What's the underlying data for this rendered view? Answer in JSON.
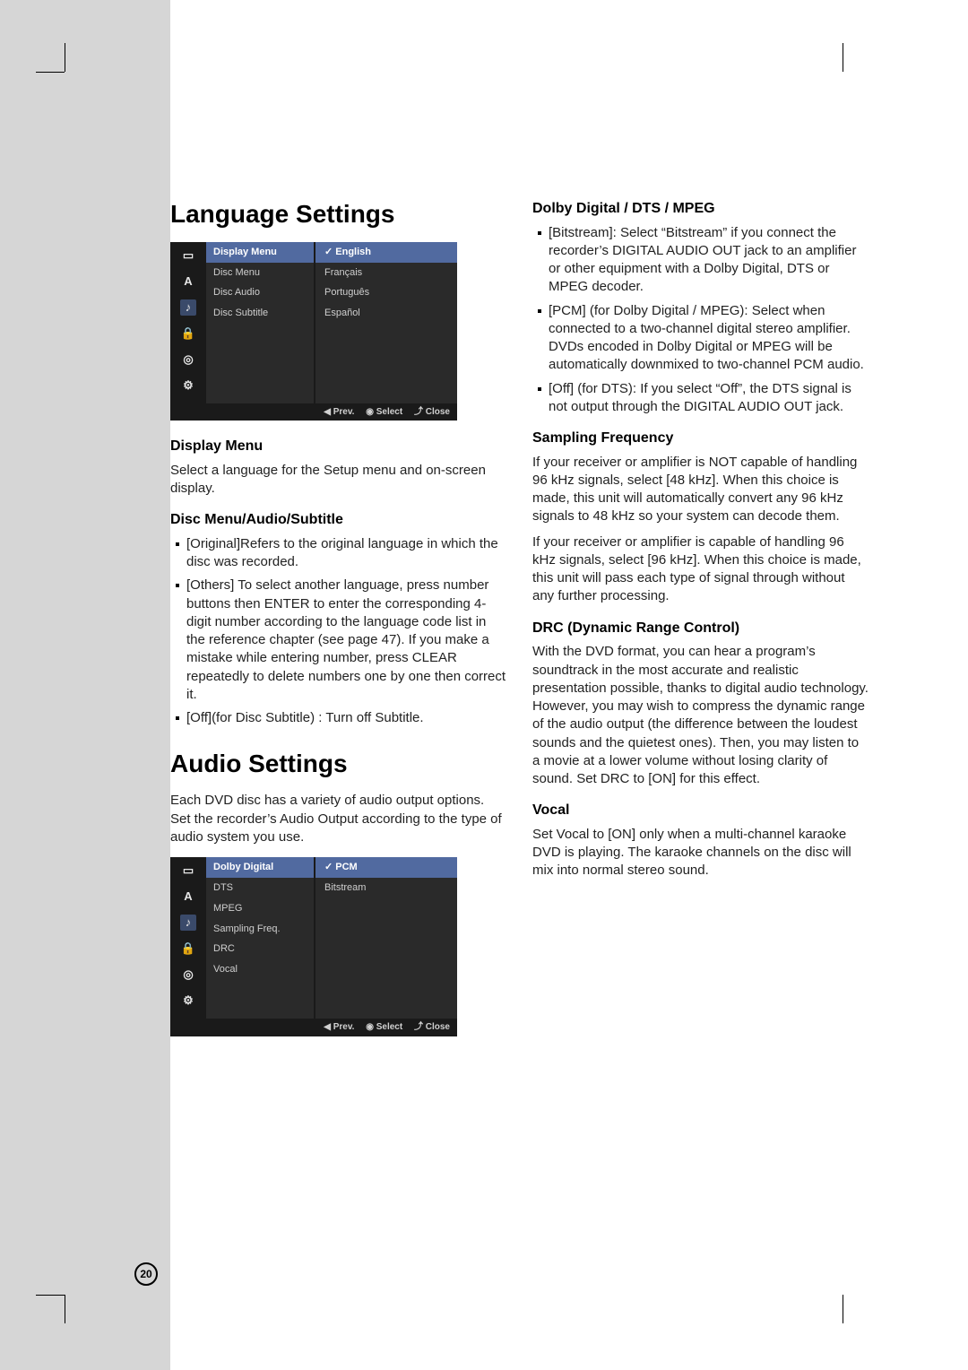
{
  "page_number": "20",
  "left": {
    "heading1": "Language Settings",
    "osd1": {
      "icons": [
        "tv",
        "A",
        "aud",
        "lock",
        "disc",
        "gear"
      ],
      "items": [
        "Display Menu",
        "Disc Menu",
        "Disc Audio",
        "Disc Subtitle"
      ],
      "selected_item": 0,
      "options": [
        "English",
        "Français",
        "Português",
        "Español"
      ],
      "selected_option": 0,
      "footer": {
        "prev": "◀ Prev.",
        "select": "◉ Select",
        "close": "⤴ Close"
      }
    },
    "display_menu_h": "Display Menu",
    "display_menu_p": "Select a language for the Setup menu and on-screen display.",
    "disc_h": "Disc Menu/Audio/Subtitle",
    "disc_bullets": [
      "[Original]Refers to the original language in which the disc was recorded.",
      "[Others] To select another language, press number buttons then ENTER to enter the corresponding 4-digit number according to the language code list in the reference chapter (see page 47). If you make a mistake while entering number, press CLEAR repeatedly to delete numbers one by one then correct it.",
      "[Off](for Disc Subtitle) : Turn off Subtitle."
    ],
    "heading2": "Audio Settings",
    "audio_intro": "Each DVD disc has a variety of audio output options. Set the recorder’s Audio Output according to the type of audio system you use.",
    "osd2": {
      "icons": [
        "tv",
        "A",
        "aud",
        "lock",
        "disc",
        "gear"
      ],
      "items": [
        "Dolby Digital",
        "DTS",
        "MPEG",
        "Sampling Freq.",
        "DRC",
        "Vocal"
      ],
      "selected_item": 0,
      "options": [
        "PCM",
        "Bitstream"
      ],
      "selected_option": 0,
      "footer": {
        "prev": "◀ Prev.",
        "select": "◉ Select",
        "close": "⤴ Close"
      }
    }
  },
  "right": {
    "dolby_h": "Dolby Digital / DTS / MPEG",
    "dolby_bullets": [
      "[Bitstream]: Select “Bitstream” if you connect the recorder’s DIGITAL AUDIO OUT jack to an amplifier or other equipment with a Dolby Digital, DTS or MPEG decoder.",
      "[PCM] (for Dolby Digital / MPEG): Select when connected to a two-channel digital stereo amplifier. DVDs encoded in Dolby Digital or MPEG will be automatically downmixed to two-channel PCM audio.",
      "[Off] (for DTS): If you select “Off”, the DTS signal is not output through the DIGITAL AUDIO OUT jack."
    ],
    "sampling_h": "Sampling Frequency",
    "sampling_p1": "If your receiver or amplifier is NOT capable of handling 96 kHz signals, select [48 kHz]. When this choice is made, this unit will automatically convert any 96 kHz signals to 48 kHz so your system can decode them.",
    "sampling_p2": "If your receiver or amplifier is capable of handling 96 kHz signals, select [96 kHz]. When this choice is made, this unit will pass each type of signal through without any further processing.",
    "drc_h": "DRC (Dynamic Range Control)",
    "drc_p": "With the DVD format, you can hear a program’s soundtrack in the most accurate and realistic presentation possible, thanks to digital audio technology. However, you may wish to compress the dynamic range of the audio output (the difference between the loudest sounds and the quietest ones). Then, you may listen to a movie at a lower volume without losing clarity of sound. Set DRC to [ON] for this effect.",
    "vocal_h": "Vocal",
    "vocal_p": "Set Vocal to [ON] only when a multi-channel karaoke DVD is playing. The karaoke channels on the disc will mix into normal stereo sound."
  }
}
